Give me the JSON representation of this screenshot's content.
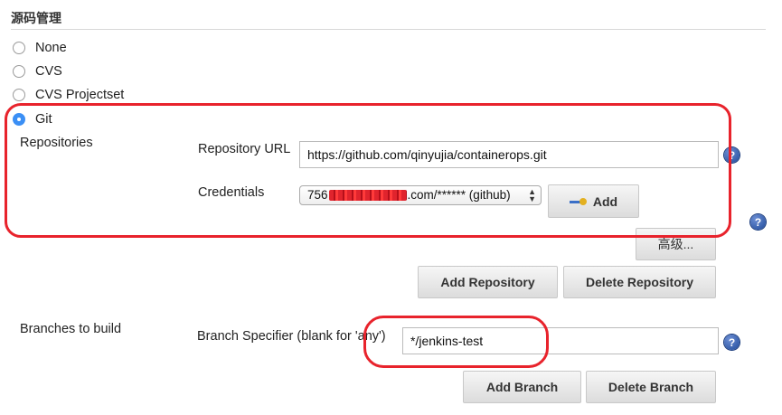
{
  "section": {
    "title": "源码管理"
  },
  "scm_options": [
    {
      "label": "None",
      "selected": false
    },
    {
      "label": "CVS",
      "selected": false
    },
    {
      "label": "CVS Projectset",
      "selected": false
    },
    {
      "label": "Git",
      "selected": true
    }
  ],
  "repositories": {
    "label": "Repositories",
    "url_label": "Repository URL",
    "url_value": "https://github.com/qinyujia/containerops.git",
    "credentials_label": "Credentials",
    "credentials_prefix": "756",
    "credentials_suffix": ".com/****** (github)",
    "add_label": "Add",
    "advanced_label": "高级...",
    "add_repository_label": "Add Repository",
    "delete_repository_label": "Delete Repository"
  },
  "branches": {
    "label": "Branches to build",
    "specifier_label": "Branch Specifier (blank for 'any')",
    "specifier_value": "*/jenkins-test",
    "add_branch_label": "Add Branch",
    "delete_branch_label": "Delete Branch"
  },
  "help": {
    "glyph": "?"
  },
  "colors": {
    "accent": "#3b8ff5",
    "annotation": "#e8232c",
    "help": "#1f4a9a"
  }
}
